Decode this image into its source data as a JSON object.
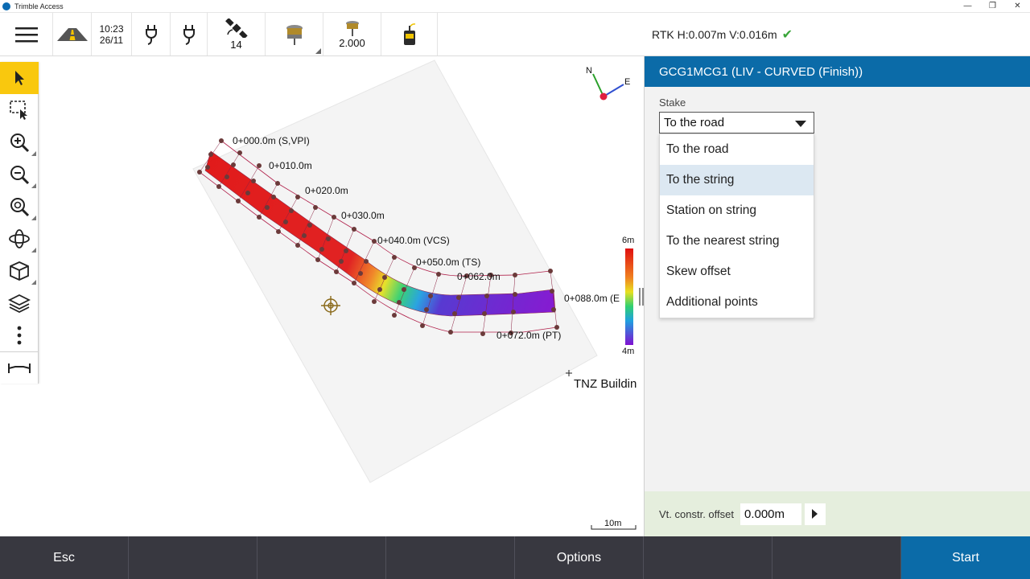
{
  "titlebar": {
    "app_title": "Trimble Access"
  },
  "status": {
    "time": "10:23",
    "date": "26/11",
    "satellites": "14",
    "target_height": "2.000"
  },
  "rtk": {
    "text": "RTK H:0.007m V:0.016m"
  },
  "map": {
    "stations": [
      "0+000.0m (S,VPI)",
      "0+010.0m",
      "0+020.0m",
      "0+030.0m",
      "0+040.0m (VCS)",
      "0+050.0m (TS)",
      "0+062.0m",
      "0+072.0m (PT)",
      "0+088.0m (E"
    ],
    "legend_top": "6m",
    "legend_bottom": "4m",
    "point_label": "TNZ Buildin",
    "scale": "10m",
    "north": "N",
    "east": "E"
  },
  "panel": {
    "title": "GCG1MCG1 (LIV - CURVED (Finish))",
    "stake_label": "Stake",
    "stake_value": "To the road",
    "options": [
      "To the road",
      "To the string",
      "Station on string",
      "To the nearest string",
      "Skew offset",
      "Additional points"
    ],
    "vt_label": "Vt. constr. offset",
    "vt_value": "0.000m"
  },
  "bottom": {
    "esc": "Esc",
    "options": "Options",
    "start": "Start"
  }
}
